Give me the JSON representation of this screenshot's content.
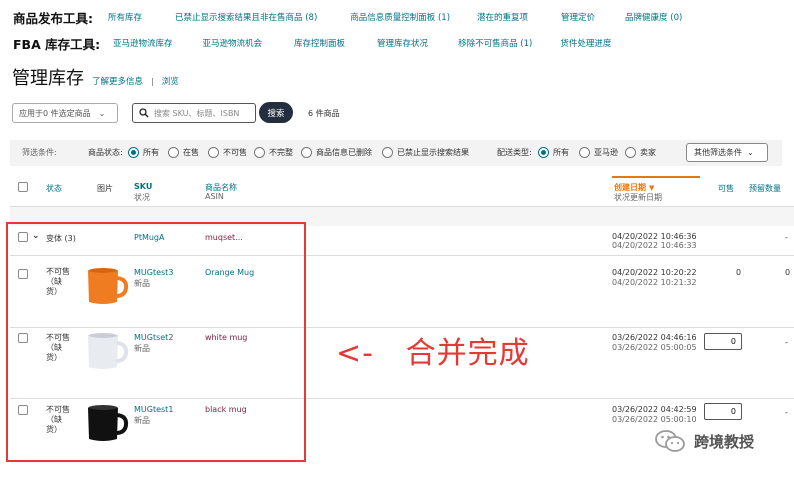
{
  "tools": {
    "publish": {
      "title": "商品发布工具:",
      "links": [
        "所有库存",
        "已禁止显示搜索结果且非在售商品 (8)",
        "商品信息质量控制面板 (1)",
        "潜在的重复项",
        "管理定价",
        "品牌健康度 (0)"
      ]
    },
    "fba": {
      "title": "FBA 库存工具:",
      "links": [
        "亚马逊物流库存",
        "亚马逊物流机会",
        "库存控制面板",
        "管理库存状况",
        "移除不可售商品 (1)",
        "货件处理进度"
      ]
    }
  },
  "page": {
    "title": "管理库存",
    "learn_more": "了解更多信息",
    "separator": "|",
    "browse": "浏览"
  },
  "toolbar": {
    "apply_label": "应用于0 件选定商品",
    "search_placeholder": "搜索 SKU、标题、ISBN",
    "search_button": "搜索",
    "count": "6 件商品"
  },
  "filters": {
    "label": "筛选条件:",
    "status_label": "商品状态:",
    "status_options": [
      "所有",
      "在售",
      "不可售",
      "不完整",
      "商品信息已删除",
      "已禁止显示搜索结果"
    ],
    "status_selected": 0,
    "fulfillment_label": "配送类型:",
    "fulfillment_options": [
      "所有",
      "亚马逊",
      "卖家"
    ],
    "fulfillment_selected": 0,
    "more_button": "其他筛选条件"
  },
  "columns": {
    "status": "状态",
    "image": "图片",
    "sku": "SKU",
    "sku_sub": "状况",
    "name": "商品名称",
    "name_sub": "ASIN",
    "created": "创建日期",
    "created_sub": "状况更新日期",
    "available": "可售",
    "reserved": "预留数量"
  },
  "rows": [
    {
      "kind": "variation",
      "status": "变体 (3)",
      "sku": "PtMugA",
      "name": "muqset...",
      "created": "04/20/2022 10:46:36",
      "updated": "04/20/2022 10:46:33",
      "available": "",
      "reserved": "-"
    },
    {
      "kind": "child",
      "status": "不可售\n（缺\n货）",
      "mug_color": "#f07c21",
      "image_icon": "mug-icon",
      "sku": "MUGtest3",
      "condition": "新品",
      "name": "Orange Mug",
      "created": "04/20/2022 10:20:22",
      "updated": "04/20/2022 10:21:32",
      "available": "0",
      "reserved": "0"
    },
    {
      "kind": "child",
      "status": "不可售\n（缺\n货）",
      "mug_color": "#e8ebf0",
      "image_icon": "mug-icon",
      "sku": "MUGtset2",
      "condition": "新品",
      "name": "white mug",
      "created": "03/26/2022 04:46:16",
      "updated": "03/26/2022 05:00:05",
      "available": "0",
      "reserved": "-"
    },
    {
      "kind": "child",
      "status": "不可售\n（缺\n货）",
      "mug_color": "#111111",
      "image_icon": "mug-icon",
      "sku": "MUGtest1",
      "condition": "新品",
      "name": "black mug",
      "created": "03/26/2022 04:42:59",
      "updated": "03/26/2022 05:00:10",
      "available": "0",
      "reserved": "-"
    }
  ],
  "annotation": {
    "text": "<-   合并完成",
    "color": "#e53935"
  },
  "watermark": {
    "text": "跨境教授",
    "icon": "wechat-icon"
  },
  "colors": {
    "link": "#007185",
    "created_header": "#e47911",
    "highlight": "#e53935"
  }
}
